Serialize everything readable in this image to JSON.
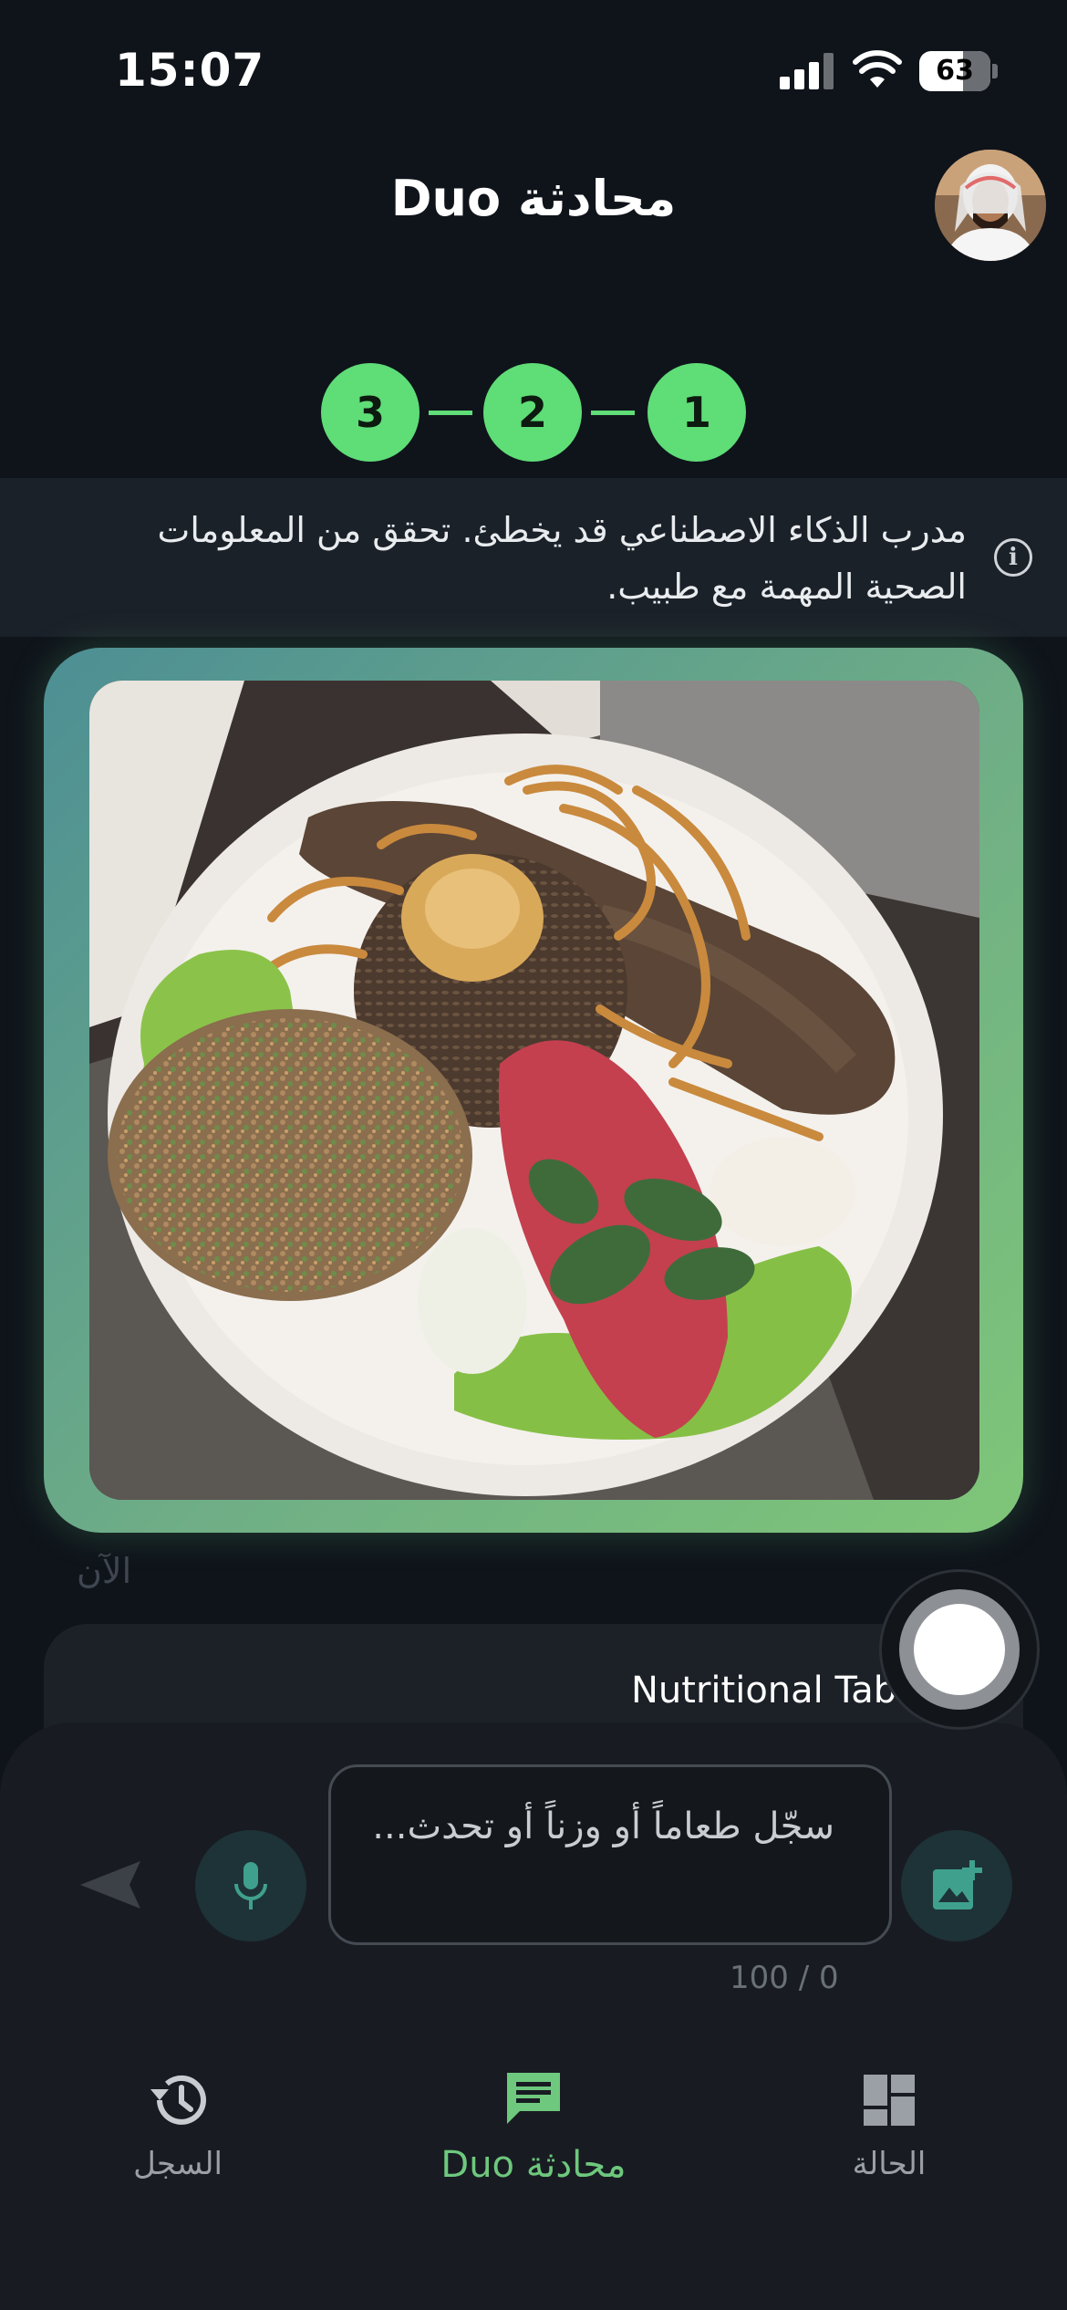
{
  "status_bar": {
    "time": "15:07",
    "battery": "63"
  },
  "header": {
    "title": "محادثة Duo"
  },
  "steps": [
    "1",
    "2",
    "3"
  ],
  "disclaimer": {
    "text": "مدرب الذكاء الاصطناعي قد يخطئ. تحقق من المعلومات الصحية المهمة مع طبيب."
  },
  "message": {
    "timestamp": "الآن",
    "text": "Nutritional Tabl"
  },
  "composer": {
    "placeholder": "سجّل طعاماً أو وزناً أو تحدث...",
    "char_count": "100 / 0"
  },
  "nav": {
    "history_label": "السجل",
    "chat_label": "محادثة Duo",
    "status_label": "الحالة"
  },
  "colors": {
    "accent": "#5fdd77",
    "nav_active": "#6ec87d",
    "background": "#0f141b"
  },
  "icons": [
    "signal-icon",
    "wifi-icon",
    "battery-icon",
    "info-icon",
    "send-icon",
    "mic-icon",
    "image-add-icon",
    "history-icon",
    "chat-icon",
    "dashboard-icon"
  ]
}
